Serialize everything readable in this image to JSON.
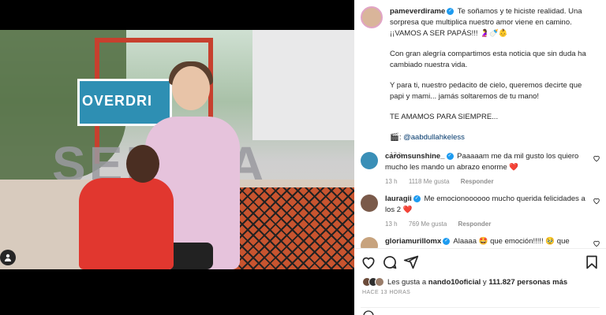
{
  "post": {
    "author": "pameverdirame",
    "caption_lines": [
      "Te soñamos y te hiciste realidad. Una sorpresa que multiplica nuestro amor viene en camino. ¡¡VAMOS A SER PAPÁS!!! 🤰🍼👶",
      "Con gran alegría compartimos esta noticia que sin duda ha cambiado nuestra vida.",
      "Y para ti, nuestro pedacito de cielo, queremos decirte que papi y mami... jamás soltaremos de tu mano!",
      "TE AMAMOS PARA SIEMPRE..."
    ],
    "photo_credit_icon": "🎬",
    "photo_credit": "@aabdullahkeless",
    "time": "13 h",
    "photo_sign_text": "OVERDRI",
    "photo_big_text": "SEMINA"
  },
  "comments": [
    {
      "user": "caromsunshine_",
      "text": "Paaaaam me da mil gusto los quiero mucho les mando un abrazo enorme ❤️",
      "time": "13 h",
      "likes": "1118 Me gusta",
      "reply": "Responder",
      "avatar_color": "#3a8fb7"
    },
    {
      "user": "lauragii",
      "text": "Me emocionoooooo mucho querida felicidades a los 2 ❤️",
      "time": "13 h",
      "likes": "769 Me gusta",
      "reply": "Responder",
      "avatar_color": "#7a5a4a"
    },
    {
      "user": "gloriamurillomx",
      "text": "Alaaaa 🤩 que emoción!!!!! 🥹 que lindos",
      "avatar_color": "#c7a37e"
    }
  ],
  "likes": {
    "prefix": "Les gusta a",
    "user": "nando10oficial",
    "connector": "y",
    "count": "111.827 personas más"
  },
  "ago": "HACE 13 HORAS",
  "colors": {
    "verified": "#1d9bf0",
    "heart_red": "#ed4956",
    "link": "#00376b",
    "muted": "#8e8e8e"
  },
  "icons": [
    "heart-icon",
    "comment-icon",
    "share-icon",
    "bookmark-icon",
    "emoji-icon",
    "user-tag-icon"
  ]
}
